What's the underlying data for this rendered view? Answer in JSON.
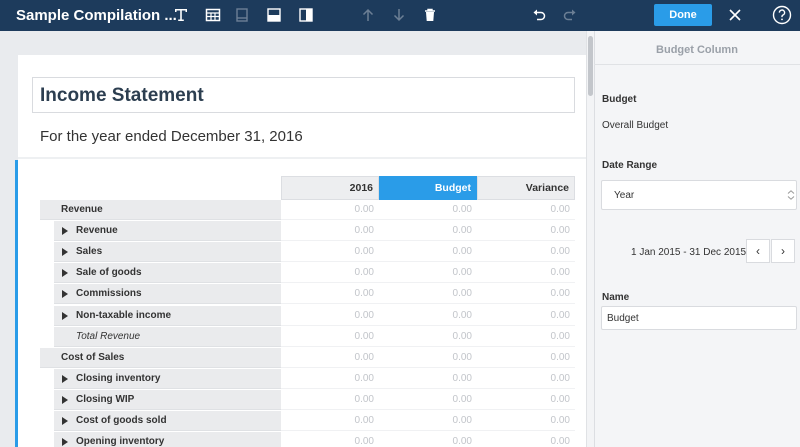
{
  "toolbar": {
    "title": "Sample Compilation ...",
    "icons": [
      "text-icon",
      "table-icon",
      "page-break-icon",
      "split-rows-icon",
      "split-columns-icon",
      "arrow-up-icon",
      "arrow-down-icon",
      "trash-icon",
      "undo-icon",
      "redo-icon",
      "close-icon",
      "help-icon"
    ],
    "done_label": "Done"
  },
  "report": {
    "heading": "Income Statement",
    "subtitle": "For the year ended December 31, 2016",
    "columns": [
      "2016",
      "Budget",
      "Variance"
    ],
    "active_column": "Budget",
    "rows": [
      {
        "label": "Revenue",
        "type": "group",
        "values": [
          "0.00",
          "0.00",
          "0.00"
        ]
      },
      {
        "label": "Revenue",
        "type": "item",
        "values": [
          "0.00",
          "0.00",
          "0.00"
        ]
      },
      {
        "label": "Sales",
        "type": "item",
        "values": [
          "0.00",
          "0.00",
          "0.00"
        ]
      },
      {
        "label": "Sale of goods",
        "type": "item",
        "values": [
          "0.00",
          "0.00",
          "0.00"
        ]
      },
      {
        "label": "Commissions",
        "type": "item",
        "values": [
          "0.00",
          "0.00",
          "0.00"
        ]
      },
      {
        "label": "Non-taxable income",
        "type": "item",
        "values": [
          "0.00",
          "0.00",
          "0.00"
        ]
      },
      {
        "label": "Total Revenue",
        "type": "total",
        "values": [
          "0.00",
          "0.00",
          "0.00"
        ]
      },
      {
        "label": "Cost of Sales",
        "type": "group",
        "values": [
          "0.00",
          "0.00",
          "0.00"
        ]
      },
      {
        "label": "Closing inventory",
        "type": "item",
        "values": [
          "0.00",
          "0.00",
          "0.00"
        ]
      },
      {
        "label": "Closing WIP",
        "type": "item",
        "values": [
          "0.00",
          "0.00",
          "0.00"
        ]
      },
      {
        "label": "Cost of goods sold",
        "type": "item",
        "values": [
          "0.00",
          "0.00",
          "0.00"
        ]
      },
      {
        "label": "Opening inventory",
        "type": "item",
        "values": [
          "0.00",
          "0.00",
          "0.00"
        ]
      }
    ]
  },
  "panel": {
    "title": "Budget Column",
    "budget_label": "Budget",
    "budget_value": "Overall Budget",
    "date_range_label": "Date Range",
    "date_range_value": "Year",
    "date_range_text": "1 Jan 2015 - 31 Dec 2015",
    "prev_symbol": "‹",
    "next_symbol": "›",
    "name_label": "Name",
    "name_value": "Budget"
  },
  "colors": {
    "toolbar": "#1d3b5c",
    "accent": "#2a9ce8"
  }
}
